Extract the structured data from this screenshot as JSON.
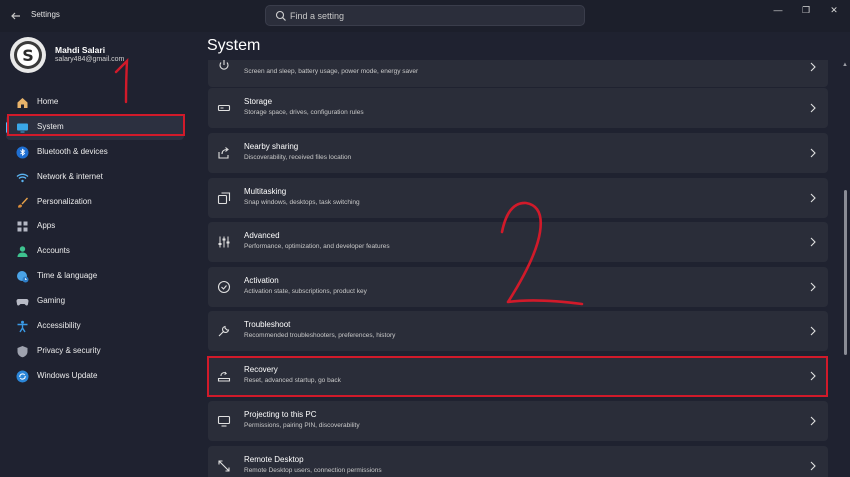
{
  "window": {
    "title": "Settings",
    "search_placeholder": "Find a setting",
    "minimize": "—",
    "maximize": "❐",
    "close": "✕"
  },
  "user": {
    "name": "Mahdi Salari",
    "email": "salary484@gmail.com"
  },
  "nav": [
    {
      "label": "Home",
      "icon": "home-icon"
    },
    {
      "label": "System",
      "icon": "system-icon",
      "active": true
    },
    {
      "label": "Bluetooth & devices",
      "icon": "bluetooth-icon"
    },
    {
      "label": "Network & internet",
      "icon": "wifi-icon"
    },
    {
      "label": "Personalization",
      "icon": "brush-icon"
    },
    {
      "label": "Apps",
      "icon": "apps-icon"
    },
    {
      "label": "Accounts",
      "icon": "person-icon"
    },
    {
      "label": "Time & language",
      "icon": "globe-clock-icon"
    },
    {
      "label": "Gaming",
      "icon": "gamepad-icon"
    },
    {
      "label": "Accessibility",
      "icon": "accessibility-icon"
    },
    {
      "label": "Privacy & security",
      "icon": "shield-icon"
    },
    {
      "label": "Windows Update",
      "icon": "update-icon"
    }
  ],
  "page": {
    "title": "System"
  },
  "settings": [
    {
      "title": "",
      "sub": "Screen and sleep, battery usage, power mode, energy saver",
      "icon": "power-icon"
    },
    {
      "title": "Storage",
      "sub": "Storage space, drives, configuration rules",
      "icon": "storage-icon"
    },
    {
      "title": "Nearby sharing",
      "sub": "Discoverability, received files location",
      "icon": "share-icon"
    },
    {
      "title": "Multitasking",
      "sub": "Snap windows, desktops, task switching",
      "icon": "multitask-icon"
    },
    {
      "title": "Advanced",
      "sub": "Performance, optimization, and developer features",
      "icon": "advanced-icon"
    },
    {
      "title": "Activation",
      "sub": "Activation state, subscriptions, product key",
      "icon": "check-circle-icon"
    },
    {
      "title": "Troubleshoot",
      "sub": "Recommended troubleshooters, preferences, history",
      "icon": "wrench-icon"
    },
    {
      "title": "Recovery",
      "sub": "Reset, advanced startup, go back",
      "icon": "recovery-icon"
    },
    {
      "title": "Projecting to this PC",
      "sub": "Permissions, pairing PIN, discoverability",
      "icon": "project-icon"
    },
    {
      "title": "Remote Desktop",
      "sub": "Remote Desktop users, connection permissions",
      "icon": "remote-icon"
    }
  ],
  "colors": {
    "accent": "#4cc2ff",
    "annotation": "#d11a2a",
    "card": "#2a2d39",
    "background": "#1f2230"
  }
}
